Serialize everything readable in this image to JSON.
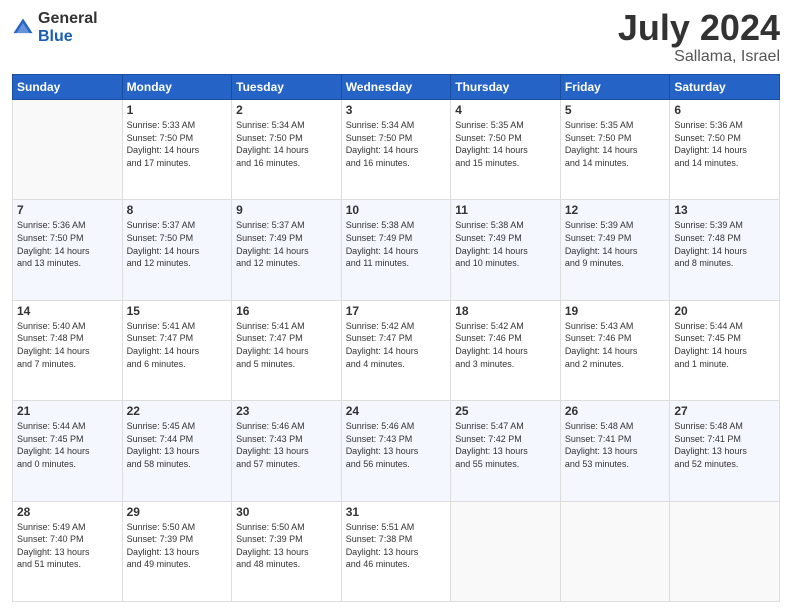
{
  "logo": {
    "general": "General",
    "blue": "Blue"
  },
  "title": {
    "month_year": "July 2024",
    "location": "Sallama, Israel"
  },
  "calendar": {
    "headers": [
      "Sunday",
      "Monday",
      "Tuesday",
      "Wednesday",
      "Thursday",
      "Friday",
      "Saturday"
    ],
    "rows": [
      [
        {
          "day": "",
          "info": ""
        },
        {
          "day": "1",
          "info": "Sunrise: 5:33 AM\nSunset: 7:50 PM\nDaylight: 14 hours\nand 17 minutes."
        },
        {
          "day": "2",
          "info": "Sunrise: 5:34 AM\nSunset: 7:50 PM\nDaylight: 14 hours\nand 16 minutes."
        },
        {
          "day": "3",
          "info": "Sunrise: 5:34 AM\nSunset: 7:50 PM\nDaylight: 14 hours\nand 16 minutes."
        },
        {
          "day": "4",
          "info": "Sunrise: 5:35 AM\nSunset: 7:50 PM\nDaylight: 14 hours\nand 15 minutes."
        },
        {
          "day": "5",
          "info": "Sunrise: 5:35 AM\nSunset: 7:50 PM\nDaylight: 14 hours\nand 14 minutes."
        },
        {
          "day": "6",
          "info": "Sunrise: 5:36 AM\nSunset: 7:50 PM\nDaylight: 14 hours\nand 14 minutes."
        }
      ],
      [
        {
          "day": "7",
          "info": "Sunrise: 5:36 AM\nSunset: 7:50 PM\nDaylight: 14 hours\nand 13 minutes."
        },
        {
          "day": "8",
          "info": "Sunrise: 5:37 AM\nSunset: 7:50 PM\nDaylight: 14 hours\nand 12 minutes."
        },
        {
          "day": "9",
          "info": "Sunrise: 5:37 AM\nSunset: 7:49 PM\nDaylight: 14 hours\nand 12 minutes."
        },
        {
          "day": "10",
          "info": "Sunrise: 5:38 AM\nSunset: 7:49 PM\nDaylight: 14 hours\nand 11 minutes."
        },
        {
          "day": "11",
          "info": "Sunrise: 5:38 AM\nSunset: 7:49 PM\nDaylight: 14 hours\nand 10 minutes."
        },
        {
          "day": "12",
          "info": "Sunrise: 5:39 AM\nSunset: 7:49 PM\nDaylight: 14 hours\nand 9 minutes."
        },
        {
          "day": "13",
          "info": "Sunrise: 5:39 AM\nSunset: 7:48 PM\nDaylight: 14 hours\nand 8 minutes."
        }
      ],
      [
        {
          "day": "14",
          "info": "Sunrise: 5:40 AM\nSunset: 7:48 PM\nDaylight: 14 hours\nand 7 minutes."
        },
        {
          "day": "15",
          "info": "Sunrise: 5:41 AM\nSunset: 7:47 PM\nDaylight: 14 hours\nand 6 minutes."
        },
        {
          "day": "16",
          "info": "Sunrise: 5:41 AM\nSunset: 7:47 PM\nDaylight: 14 hours\nand 5 minutes."
        },
        {
          "day": "17",
          "info": "Sunrise: 5:42 AM\nSunset: 7:47 PM\nDaylight: 14 hours\nand 4 minutes."
        },
        {
          "day": "18",
          "info": "Sunrise: 5:42 AM\nSunset: 7:46 PM\nDaylight: 14 hours\nand 3 minutes."
        },
        {
          "day": "19",
          "info": "Sunrise: 5:43 AM\nSunset: 7:46 PM\nDaylight: 14 hours\nand 2 minutes."
        },
        {
          "day": "20",
          "info": "Sunrise: 5:44 AM\nSunset: 7:45 PM\nDaylight: 14 hours\nand 1 minute."
        }
      ],
      [
        {
          "day": "21",
          "info": "Sunrise: 5:44 AM\nSunset: 7:45 PM\nDaylight: 14 hours\nand 0 minutes."
        },
        {
          "day": "22",
          "info": "Sunrise: 5:45 AM\nSunset: 7:44 PM\nDaylight: 13 hours\nand 58 minutes."
        },
        {
          "day": "23",
          "info": "Sunrise: 5:46 AM\nSunset: 7:43 PM\nDaylight: 13 hours\nand 57 minutes."
        },
        {
          "day": "24",
          "info": "Sunrise: 5:46 AM\nSunset: 7:43 PM\nDaylight: 13 hours\nand 56 minutes."
        },
        {
          "day": "25",
          "info": "Sunrise: 5:47 AM\nSunset: 7:42 PM\nDaylight: 13 hours\nand 55 minutes."
        },
        {
          "day": "26",
          "info": "Sunrise: 5:48 AM\nSunset: 7:41 PM\nDaylight: 13 hours\nand 53 minutes."
        },
        {
          "day": "27",
          "info": "Sunrise: 5:48 AM\nSunset: 7:41 PM\nDaylight: 13 hours\nand 52 minutes."
        }
      ],
      [
        {
          "day": "28",
          "info": "Sunrise: 5:49 AM\nSunset: 7:40 PM\nDaylight: 13 hours\nand 51 minutes."
        },
        {
          "day": "29",
          "info": "Sunrise: 5:50 AM\nSunset: 7:39 PM\nDaylight: 13 hours\nand 49 minutes."
        },
        {
          "day": "30",
          "info": "Sunrise: 5:50 AM\nSunset: 7:39 PM\nDaylight: 13 hours\nand 48 minutes."
        },
        {
          "day": "31",
          "info": "Sunrise: 5:51 AM\nSunset: 7:38 PM\nDaylight: 13 hours\nand 46 minutes."
        },
        {
          "day": "",
          "info": ""
        },
        {
          "day": "",
          "info": ""
        },
        {
          "day": "",
          "info": ""
        }
      ]
    ]
  }
}
